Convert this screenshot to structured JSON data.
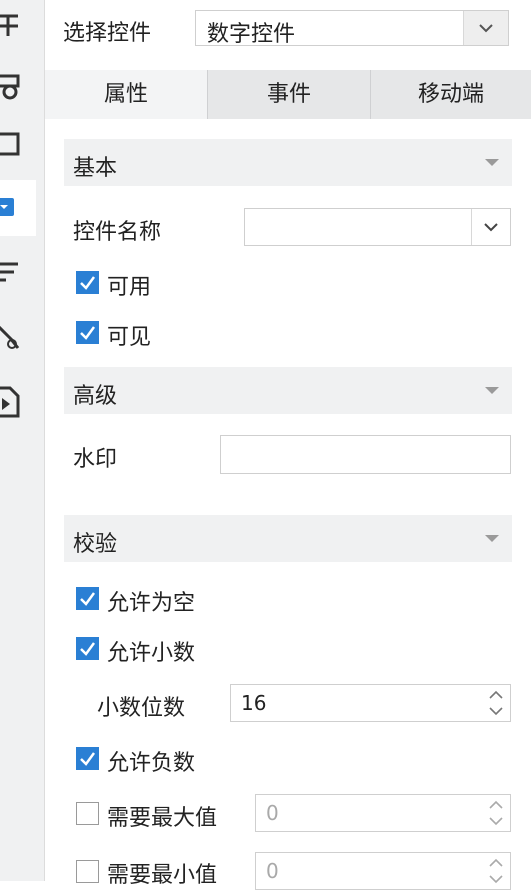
{
  "select_row": {
    "label": "选择控件",
    "value": "数字控件"
  },
  "tabs": [
    {
      "label": "属性",
      "active": true
    },
    {
      "label": "事件",
      "active": false
    },
    {
      "label": "移动端",
      "active": false
    }
  ],
  "basic": {
    "title": "基本",
    "control_name_label": "控件名称",
    "control_name_value": "",
    "enabled": {
      "label": "可用",
      "checked": true
    },
    "visible": {
      "label": "可见",
      "checked": true
    }
  },
  "advanced": {
    "title": "高级",
    "watermark_label": "水印",
    "watermark_value": ""
  },
  "validation": {
    "title": "校验",
    "allow_empty": {
      "label": "允许为空",
      "checked": true
    },
    "allow_decimal": {
      "label": "允许小数",
      "checked": true
    },
    "decimal_places": {
      "label": "小数位数",
      "value": "16"
    },
    "allow_negative": {
      "label": "允许负数",
      "checked": true
    },
    "require_max": {
      "label": "需要最大值",
      "checked": false,
      "value": "0"
    },
    "require_min": {
      "label": "需要最小值",
      "checked": false,
      "value": "0"
    }
  },
  "colors": {
    "accent": "#2a7fd4",
    "section_bg": "#f0f1f2",
    "tab_bg": "#e6e7e8"
  },
  "icons": [
    "layout-icon",
    "widget-icon",
    "frame-icon",
    "dropdown-widget-icon",
    "list-icon",
    "link-icon",
    "file-export-icon"
  ]
}
